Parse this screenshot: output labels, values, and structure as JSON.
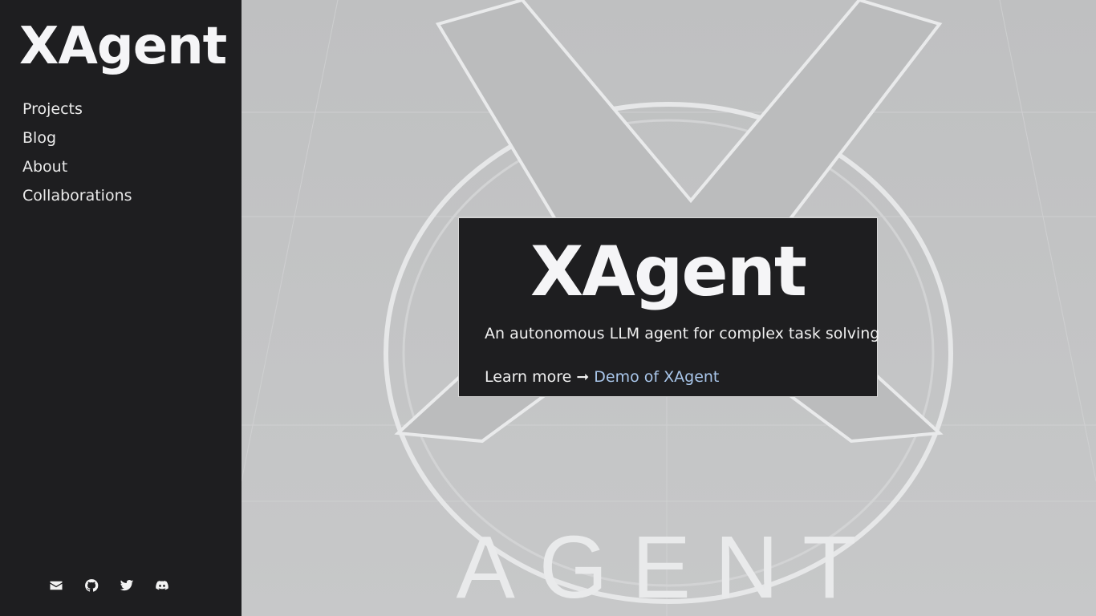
{
  "sidebar": {
    "brand": "XAgent",
    "nav": [
      "Projects",
      "Blog",
      "About",
      "Collaborations"
    ],
    "social_icons": [
      "mail-icon",
      "github-icon",
      "twitter-icon",
      "discord-icon"
    ]
  },
  "hero": {
    "background_text": "AGENT",
    "title": "XAgent",
    "subtitle": "An autonomous LLM agent for complex task solving",
    "learn_more": "Learn more",
    "arrow": "➞",
    "demo_link": "Demo of XAgent",
    "colors": {
      "link": "#a9c6ea",
      "panel": "#1e1e20"
    }
  }
}
